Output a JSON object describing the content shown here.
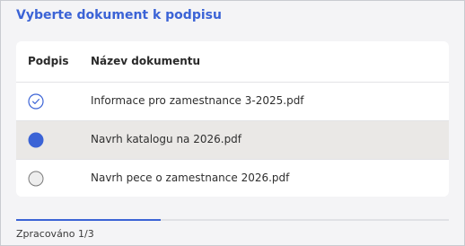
{
  "title": "Vyberte dokument k podpisu",
  "table": {
    "headers": {
      "signature": "Podpis",
      "name": "Název dokumentu"
    },
    "rows": [
      {
        "name": "Informace pro zamestnance 3-2025.pdf",
        "state": "signed",
        "icon": "check-circle-icon"
      },
      {
        "name": "Navrh katalogu na 2026.pdf",
        "state": "selected",
        "icon": "filled-circle-icon"
      },
      {
        "name": "Navrh pece o zamestnance 2026.pdf",
        "state": "empty",
        "icon": "empty-circle-icon"
      }
    ]
  },
  "progress": {
    "label": "Zpracováno 1/3",
    "done": 1,
    "total": 3
  },
  "colors": {
    "accent": "#3b63d6",
    "selected_row": "#eae8e6",
    "background": "#f4f4f6"
  }
}
